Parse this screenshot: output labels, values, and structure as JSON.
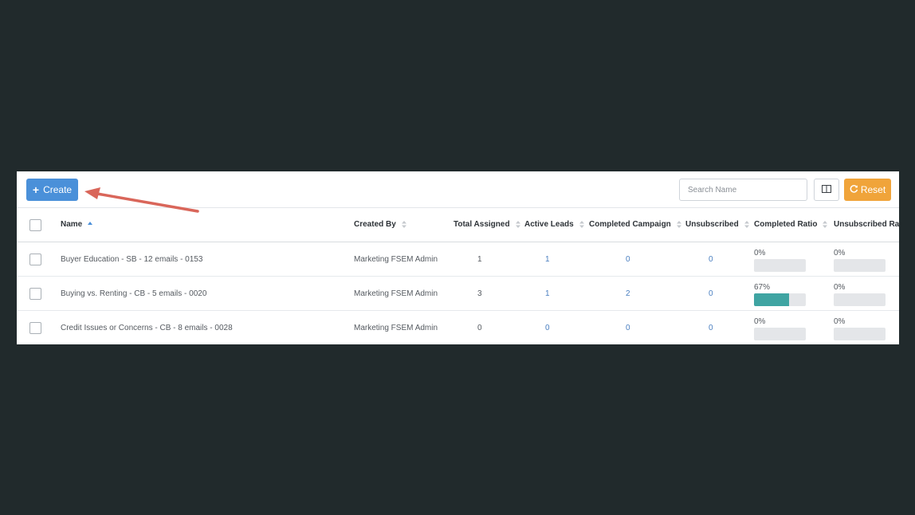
{
  "toolbar": {
    "create_label": "Create",
    "search_placeholder": "Search Name",
    "reset_label": "Reset"
  },
  "table": {
    "columns": [
      {
        "label": "Name",
        "sort": "asc"
      },
      {
        "label": "Created By",
        "sort": "none"
      },
      {
        "label": "Total Assigned",
        "sort": "none"
      },
      {
        "label": "Active Leads",
        "sort": "none"
      },
      {
        "label": "Completed Campaign",
        "sort": "none"
      },
      {
        "label": "Unsubscribed",
        "sort": "none"
      },
      {
        "label": "Completed Ratio",
        "sort": "none"
      },
      {
        "label": "Unsubscribed Rati",
        "sort": "none"
      }
    ],
    "rows": [
      {
        "name": "Buyer Education - SB - 12 emails - 0153",
        "created_by": "Marketing FSEM Admin",
        "total_assigned": "1",
        "active_leads": "1",
        "completed_campaign": "0",
        "unsubscribed": "0",
        "completed_ratio": "0%",
        "completed_ratio_value": 0,
        "unsubscribed_ratio": "0%",
        "unsubscribed_ratio_value": 0
      },
      {
        "name": "Buying vs. Renting - CB - 5 emails - 0020",
        "created_by": "Marketing FSEM Admin",
        "total_assigned": "3",
        "active_leads": "1",
        "completed_campaign": "2",
        "unsubscribed": "0",
        "completed_ratio": "67%",
        "completed_ratio_value": 0.67,
        "unsubscribed_ratio": "0%",
        "unsubscribed_ratio_value": 0
      },
      {
        "name": "Credit Issues or Concerns - CB - 8 emails - 0028",
        "created_by": "Marketing FSEM Admin",
        "total_assigned": "0",
        "active_leads": "0",
        "completed_campaign": "0",
        "unsubscribed": "0",
        "completed_ratio": "0%",
        "completed_ratio_value": 0,
        "unsubscribed_ratio": "0%",
        "unsubscribed_ratio_value": 0
      }
    ]
  },
  "colors": {
    "background": "#212a2c",
    "primary": "#4a90d9",
    "warning": "#f0a43a",
    "progress": "#3fa4a2",
    "annotation_arrow": "#d9665a"
  },
  "icons": {
    "create": "plus-icon",
    "columns": "columns-icon",
    "reset": "refresh-icon",
    "annotation": "arrow-pointer-icon"
  }
}
